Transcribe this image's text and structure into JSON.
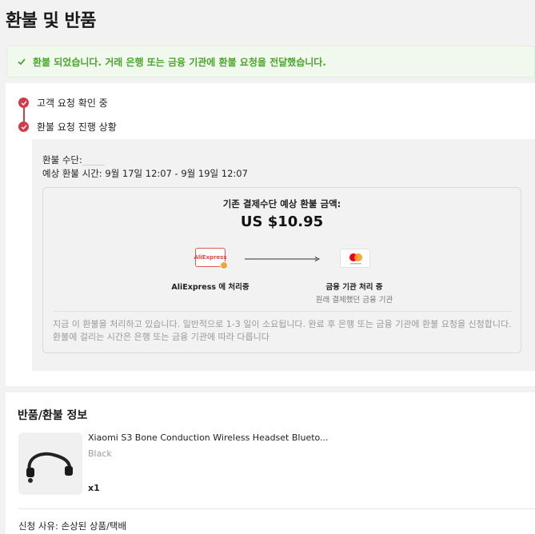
{
  "page": {
    "title": "환불 및 반품"
  },
  "alert": {
    "message": "환불 되었습니다. 거래 은행 또는 금융 기관에 환불 요청을 전달했습니다.",
    "color": "#49a62c"
  },
  "timeline": {
    "steps": [
      {
        "label": "고객 요청 확인 중"
      },
      {
        "label": "환불 요청 진행 상황"
      }
    ],
    "accent": "#d23b48"
  },
  "refund": {
    "method_label": "환불 수단:",
    "eta_label": "예상 환불 시간:",
    "eta_value": "9월 17일 12:07 - 9월 19일 12:07",
    "amount_label": "기존 결제수단 예상 환불 금액:",
    "amount": "US $10.95",
    "from": {
      "logo_text": "AliExpress",
      "label": "AliExpress 에 처리중"
    },
    "to": {
      "label": "금융 기관 처리 중",
      "sub": "원래 결제했던 금융 기관"
    },
    "note": "지금 이 환불을 처리하고 있습니다. 일반적으로 1-3 일이 소요됩니다. 완료 후 은행 또는 금융 기관에 환불 요청을 신청합니다. 환불에 걸리는 시간은 은행 또는 금융 기관에 따라 다릅니다"
  },
  "return_info": {
    "title": "반품/환불 정보",
    "product": {
      "title": "Xiaomi S3 Bone Conduction Wireless Headset Blueto...",
      "variant": "Black",
      "quantity": "x1"
    },
    "reason": "신청 사유: 손상된 상품/택배"
  }
}
